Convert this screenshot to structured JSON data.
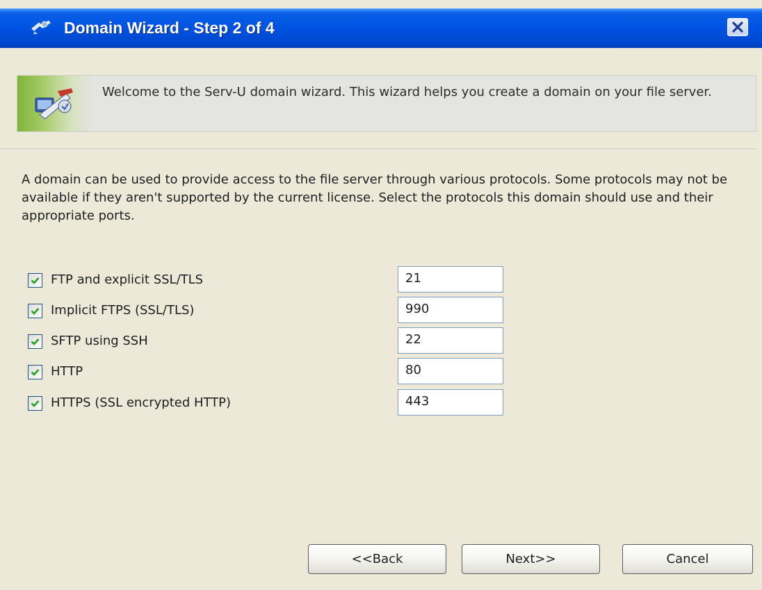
{
  "window": {
    "title": "Domain Wizard - Step 2 of 4",
    "icons": {
      "title": "wizard-icon",
      "close": "close-icon"
    }
  },
  "banner": {
    "text": "Welcome to the Serv-U domain wizard. This wizard helps you create a domain on your file server.",
    "icon": "domain-wizard-icon"
  },
  "description": "A domain can be used to provide access to the file server through various protocols. Some protocols may not be available if they aren't supported by the current license. Select the protocols this domain should use and their appropriate ports.",
  "protocols": [
    {
      "label": "FTP and explicit SSL/TLS",
      "checked": true,
      "port": "21"
    },
    {
      "label": "Implicit FTPS (SSL/TLS)",
      "checked": true,
      "port": "990"
    },
    {
      "label": "SFTP using SSH",
      "checked": true,
      "port": "22"
    },
    {
      "label": "HTTP",
      "checked": true,
      "port": "80"
    },
    {
      "label": "HTTPS (SSL encrypted HTTP)",
      "checked": true,
      "port": "443"
    }
  ],
  "buttons": {
    "back": "<<Back",
    "next": "Next>>",
    "cancel": "Cancel"
  },
  "colors": {
    "titlebar": "#0054e3",
    "dialog_bg": "#ece9d8",
    "check": "#21a121",
    "input_border": "#7f9db9"
  }
}
